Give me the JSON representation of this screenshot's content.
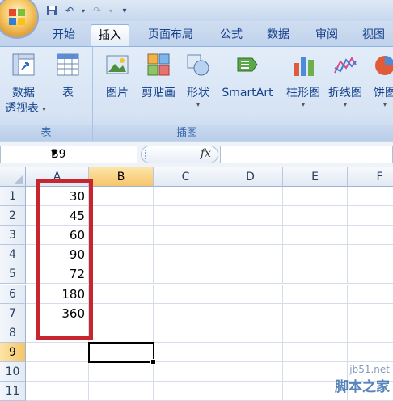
{
  "quick_access": {
    "icons": [
      "save-icon",
      "undo-icon",
      "redo-icon",
      "customize-icon"
    ]
  },
  "tabs": [
    {
      "label": "开始",
      "active": false
    },
    {
      "label": "插入",
      "active": true
    },
    {
      "label": "页面布局",
      "active": false
    },
    {
      "label": "公式",
      "active": false
    },
    {
      "label": "数据",
      "active": false
    },
    {
      "label": "审阅",
      "active": false
    },
    {
      "label": "视图",
      "active": false
    }
  ],
  "ribbon": {
    "groups": [
      {
        "label": "表",
        "buttons": [
          {
            "line1": "数据",
            "line2": "透视表",
            "has_dropdown": true,
            "icon": "pivot-table-icon"
          },
          {
            "line1": "表",
            "line2": "",
            "has_dropdown": false,
            "icon": "table-icon"
          }
        ]
      },
      {
        "label": "插图",
        "buttons": [
          {
            "line1": "图片",
            "line2": "",
            "has_dropdown": false,
            "icon": "picture-icon"
          },
          {
            "line1": "剪贴画",
            "line2": "",
            "has_dropdown": false,
            "icon": "clipart-icon"
          },
          {
            "line1": "形状",
            "line2": "",
            "has_dropdown": true,
            "icon": "shapes-icon"
          },
          {
            "line1": "SmartArt",
            "line2": "",
            "has_dropdown": false,
            "icon": "smartart-icon"
          }
        ]
      },
      {
        "label": "",
        "buttons": [
          {
            "line1": "柱形图",
            "line2": "",
            "has_dropdown": true,
            "icon": "column-chart-icon"
          },
          {
            "line1": "折线图",
            "line2": "",
            "has_dropdown": true,
            "icon": "line-chart-icon"
          },
          {
            "line1": "饼图",
            "line2": "",
            "has_dropdown": true,
            "icon": "pie-chart-icon"
          }
        ]
      }
    ]
  },
  "formula_bar": {
    "name_box": "B9",
    "fx_label": "fx",
    "formula": ""
  },
  "sheet": {
    "columns": [
      "A",
      "B",
      "C",
      "D",
      "E",
      "F"
    ],
    "selected_column": "B",
    "rows": [
      "1",
      "2",
      "3",
      "4",
      "5",
      "6",
      "7",
      "8",
      "9",
      "10",
      "11"
    ],
    "selected_row": "9",
    "column_a_values": [
      "30",
      "45",
      "60",
      "90",
      "72",
      "180",
      "360",
      "",
      "",
      "",
      ""
    ],
    "active_cell": "B9"
  },
  "watermark": {
    "site": "jb51.net",
    "text": "脚本之家"
  },
  "colors": {
    "highlight_box": "#c8262e",
    "tab_text": "#15428b"
  }
}
